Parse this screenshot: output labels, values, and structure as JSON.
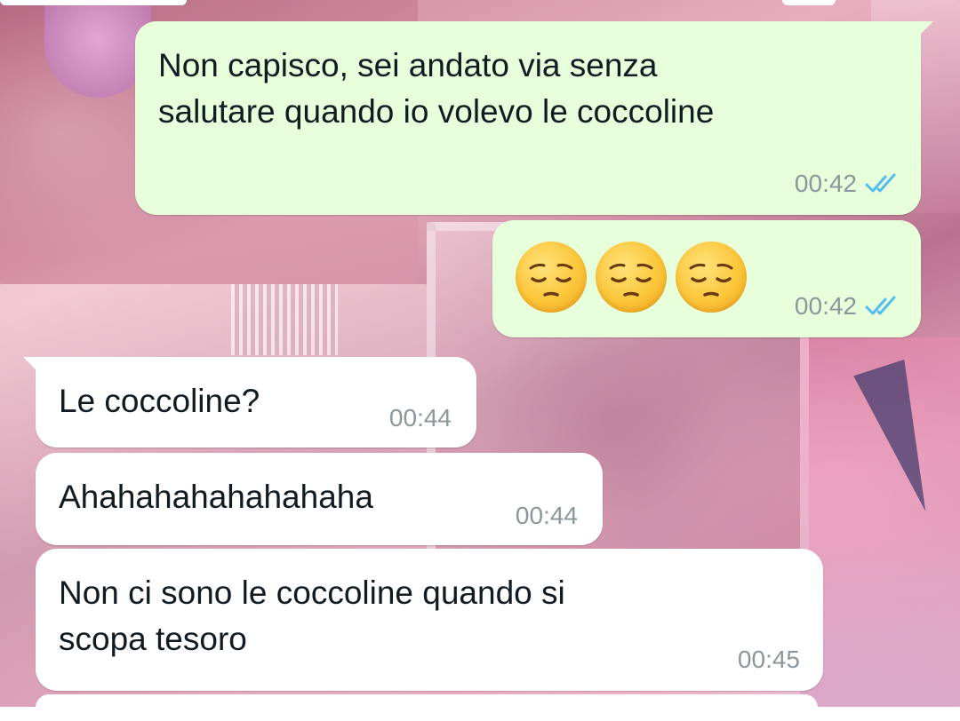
{
  "theme": {
    "outgoing_bubble": "#e7ffdb",
    "incoming_bubble": "#ffffff",
    "text": "#111b21",
    "time": "#8c969b",
    "read_tick": "#53bdeb"
  },
  "messages": [
    {
      "direction": "outgoing",
      "lines": [
        "Non capisco, sei andato via senza",
        "salutare quando io volevo le coccoline"
      ],
      "time": "00:42",
      "status": "read"
    },
    {
      "direction": "outgoing",
      "emoji": [
        "pensive-face-icon",
        "pensive-face-icon",
        "pensive-face-icon"
      ],
      "time": "00:42",
      "status": "read"
    },
    {
      "direction": "incoming",
      "lines": [
        "Le coccoline?"
      ],
      "time": "00:44"
    },
    {
      "direction": "incoming",
      "lines": [
        "Ahahahahahahahaha"
      ],
      "time": "00:44"
    },
    {
      "direction": "incoming",
      "lines": [
        "Non ci sono le coccoline quando si",
        "scopa tesoro"
      ],
      "time": "00:45"
    }
  ]
}
